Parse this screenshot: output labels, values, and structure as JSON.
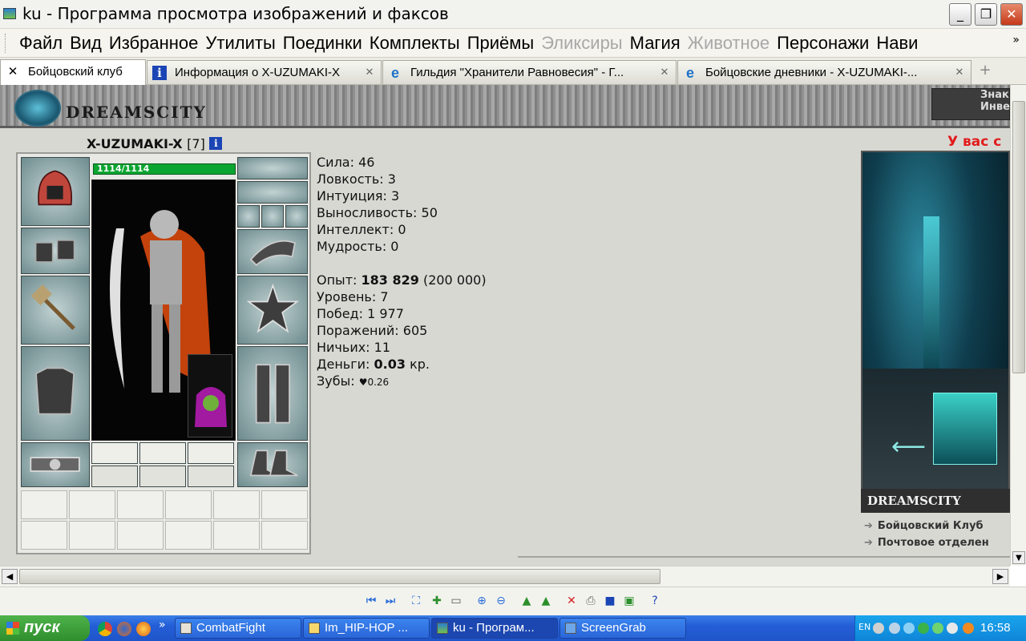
{
  "window": {
    "title": "ku - Программа просмотра изображений и факсов",
    "controls": {
      "minimize": "_",
      "maximize": "❐",
      "close": "✕"
    }
  },
  "menu": {
    "items": [
      {
        "label": "Файл",
        "enabled": true
      },
      {
        "label": "Вид",
        "enabled": true
      },
      {
        "label": "Избранное",
        "enabled": true
      },
      {
        "label": "Утилиты",
        "enabled": true
      },
      {
        "label": "Поединки",
        "enabled": true
      },
      {
        "label": "Комплекты",
        "enabled": true
      },
      {
        "label": "Приёмы",
        "enabled": true
      },
      {
        "label": "Эликсиры",
        "enabled": false
      },
      {
        "label": "Магия",
        "enabled": true
      },
      {
        "label": "Животное",
        "enabled": false
      },
      {
        "label": "Персонажи",
        "enabled": true
      },
      {
        "label": "Нави",
        "enabled": true
      }
    ],
    "more": "»"
  },
  "tabs": [
    {
      "label": "Бойцовский клуб",
      "icon": "close-icon"
    },
    {
      "label": "Информация о X-UZUMAKI-X",
      "icon": "info-icon"
    },
    {
      "label": "Гильдия \"Хранители Равновесия\" - Г...",
      "icon": "ie-icon"
    },
    {
      "label": "Бойцовские дневники - X-UZUMAKI-...",
      "icon": "ie-icon"
    }
  ],
  "header": {
    "logo": "DREAMSCITY",
    "right_lines": [
      "Знак",
      "Инве"
    ]
  },
  "character": {
    "name": "X-UZUMAKI-X",
    "level": "[7]",
    "hp": "1114/1114",
    "hp_fraction": 1.0
  },
  "stats": {
    "strength": "Сила: 46",
    "agility": "Ловкость: 3",
    "intuition": "Интуиция: 3",
    "endurance": "Выносливость: 50",
    "intellect": "Интеллект: 0",
    "wisdom": "Мудрость: 0",
    "exp_label": "Опыт: ",
    "exp_value": "183 829",
    "exp_next": " (200 000)",
    "level": "Уровень: 7",
    "wins": "Побед: 1 977",
    "losses": "Поражений: 605",
    "draws": "Ничьих: 11",
    "money_label": "Деньги: ",
    "money_value": "0.03",
    "money_unit": " кр.",
    "teeth_label": "Зубы: ",
    "teeth_value": "♥0.26"
  },
  "side": {
    "warning": "У вас с",
    "banner_caption": "DREAMSCITY",
    "links": [
      "Бойцовский Клуб",
      "Почтовое отделен"
    ]
  },
  "taskbar": {
    "start": "пуск",
    "tasks": [
      "CombatFight",
      "Im_HIP-HOP ...",
      "ku - Програм...",
      "ScreenGrab"
    ],
    "quicklaunch_more": "»",
    "lang": "EN",
    "clock": "16:58"
  },
  "colors": {
    "accent": "#245ed7",
    "hp": "#0aa530",
    "warning": "#e21b1b"
  }
}
